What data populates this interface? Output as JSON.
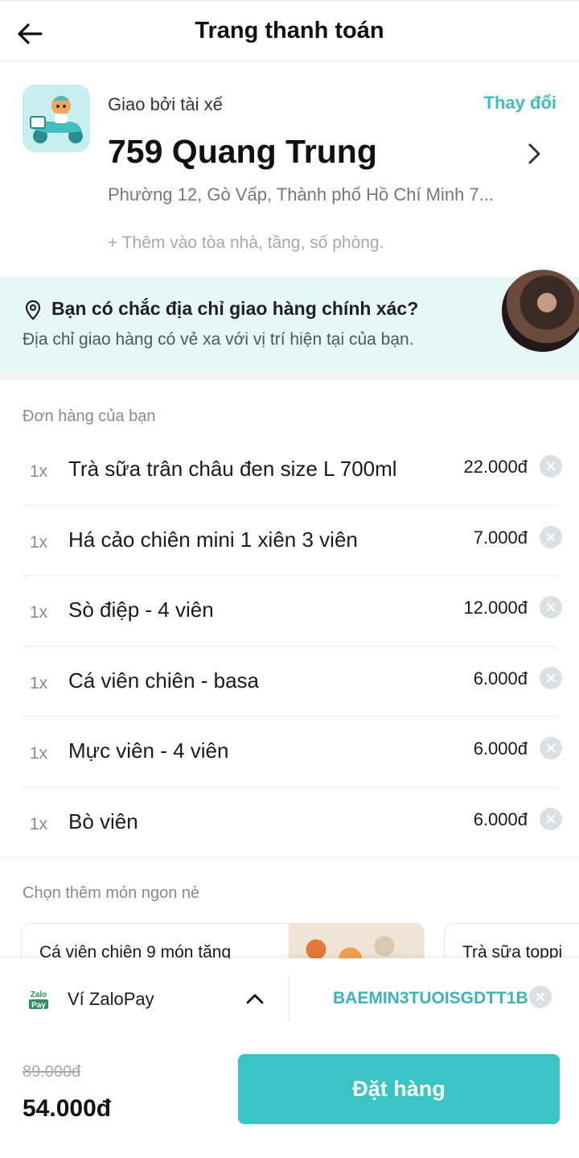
{
  "header": {
    "title": "Trang thanh toán"
  },
  "address": {
    "delivered_by": "Giao bởi tài xế",
    "change": "Thay đổi",
    "name": "759 Quang Trung",
    "detail": "Phường 12, Gò Vấp, Thành phố Hồ Chí Minh 7...",
    "add_building": "+ Thêm vào tòa nhà, tầng, số phòng."
  },
  "warning": {
    "title": "Bạn có chắc địa chỉ giao hàng chính xác?",
    "subtitle": "Địa chỉ giao hàng có vẻ xa với vị trí hiện tại của bạn."
  },
  "order": {
    "label": "Đơn hàng của bạn",
    "items": [
      {
        "qty": "1x",
        "name": "Trà sữa trân châu đen size L 700ml",
        "price": "22.000đ"
      },
      {
        "qty": "1x",
        "name": "Há cảo chiên mini 1 xiên 3 viên",
        "price": "7.000đ"
      },
      {
        "qty": "1x",
        "name": "Sò điệp - 4 viên",
        "price": "12.000đ"
      },
      {
        "qty": "1x",
        "name": "Cá viên chiên - basa",
        "price": "6.000đ"
      },
      {
        "qty": "1x",
        "name": "Mực viên - 4 viên",
        "price": "6.000đ"
      },
      {
        "qty": "1x",
        "name": "Bò viên",
        "price": "6.000đ"
      }
    ]
  },
  "suggestions": {
    "label": "Chọn thêm món ngon nè",
    "items": [
      {
        "name": "Cá viên chiên 9 món tăng"
      },
      {
        "name": "Trà sữa toppi"
      }
    ]
  },
  "payment": {
    "method": "Ví ZaloPay",
    "logo_text_top": "Zalo",
    "logo_text_bottom": "Pay",
    "promo_code": "BAEMIN3TUOISGDTT1B"
  },
  "totals": {
    "original": "89.000đ",
    "final": "54.000đ",
    "order_button": "Đặt hàng"
  },
  "colors": {
    "accent": "#3bc4c6",
    "banner": "#e6f7f6",
    "remove_bg": "#dcdfe3"
  }
}
